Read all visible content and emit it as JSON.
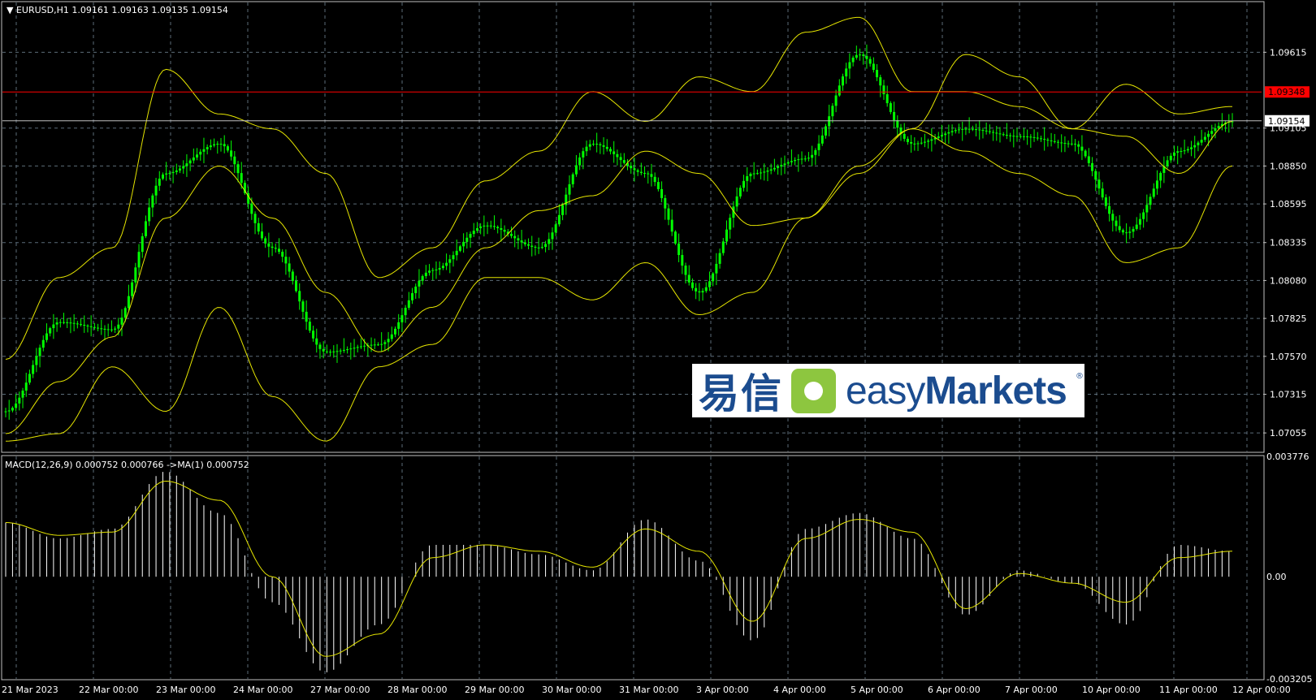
{
  "header": {
    "symbol": "EURUSD,H1",
    "ohlc": "1.09161 1.09163 1.09135 1.09154"
  },
  "macd_header": "MACD(12,26,9) 0.000752 0.000766 ->MA(1) 0.000752",
  "logo": {
    "cn": "易信",
    "en_light": "easy",
    "en_bold": "Markets",
    "reg": "®"
  },
  "colors": {
    "background": "#000000",
    "grid": "#5b6b78",
    "candles": "#00ff00",
    "bands": "#e6e600",
    "hline": "#ff0000",
    "last_price": "#c0c0c0",
    "macd_hist": "#ffffff"
  },
  "chart_data": [
    {
      "type": "line",
      "title": "EURUSD,H1",
      "ylim": [
        1.0693,
        1.0995
      ],
      "y_ticks": [
        "1.09615",
        "1.09105",
        "1.08850",
        "1.08595",
        "1.08335",
        "1.08080",
        "1.07825",
        "1.07570",
        "1.07315",
        "1.07055"
      ],
      "horizontal_line": {
        "value": "1.09348",
        "color": "#ff0000"
      },
      "last_price": "1.09154",
      "x_tick_labels": [
        "21 Mar 2023",
        "22 Mar 00:00",
        "23 Mar 00:00",
        "24 Mar 00:00",
        "27 Mar 00:00",
        "28 Mar 00:00",
        "29 Mar 00:00",
        "30 Mar 00:00",
        "31 Mar 00:00",
        "3 Apr 00:00",
        "4 Apr 00:00",
        "5 Apr 00:00",
        "6 Apr 00:00",
        "7 Apr 00:00",
        "10 Apr 00:00",
        "11 Apr 00:00",
        "12 Apr 00:00"
      ],
      "series": [
        {
          "name": "Bollinger middle",
          "values": [
            1.0705,
            1.074,
            1.077,
            1.085,
            1.0885,
            1.085,
            1.08,
            1.076,
            1.079,
            1.083,
            1.0855,
            1.0865,
            1.0895,
            1.088,
            1.0845,
            1.085,
            1.088,
            1.091,
            1.096,
            1.0945,
            1.091,
            1.0905,
            1.088,
            1.0915
          ]
        },
        {
          "name": "Bollinger upper",
          "values": [
            1.0755,
            1.081,
            1.083,
            1.095,
            1.092,
            1.091,
            1.088,
            1.081,
            1.083,
            1.0875,
            1.0895,
            1.0935,
            1.0915,
            1.0945,
            1.0935,
            1.0975,
            1.0985,
            1.0935,
            1.0935,
            1.0925,
            1.091,
            1.094,
            1.092,
            1.0925
          ]
        },
        {
          "name": "Bollinger lower",
          "values": [
            1.07,
            1.0705,
            1.075,
            1.072,
            1.079,
            1.073,
            1.07,
            1.075,
            1.0765,
            1.081,
            1.081,
            1.0795,
            1.082,
            1.0785,
            1.08,
            1.085,
            1.0885,
            1.091,
            1.0895,
            1.088,
            1.0865,
            1.082,
            1.083,
            1.0885
          ]
        },
        {
          "name": "Close",
          "values": [
            1.072,
            1.078,
            1.0775,
            1.088,
            1.09,
            1.083,
            1.076,
            1.0765,
            1.0815,
            1.0845,
            1.083,
            1.09,
            1.088,
            1.08,
            1.088,
            1.089,
            1.096,
            1.09,
            1.091,
            1.0905,
            1.09,
            1.084,
            1.0895,
            1.0915
          ]
        }
      ]
    },
    {
      "type": "bar",
      "title": "MACD(12,26,9)",
      "ylim": [
        -0.003205,
        0.003776
      ],
      "y_ticks": [
        "0.003776",
        "0.00",
        "-0.003205"
      ],
      "series": [
        {
          "name": "MACD",
          "values": [
            0.0017,
            0.0012,
            0.0015,
            0.0033,
            0.002,
            -0.0008,
            -0.003,
            -0.0015,
            0.001,
            0.001,
            0.0007,
            0.0002,
            0.0018,
            0.0005,
            -0.002,
            0.0015,
            0.002,
            0.0012,
            -0.0012,
            0.0002,
            -0.0002,
            -0.0015,
            0.001,
            0.0008
          ]
        },
        {
          "name": "Signal",
          "values": [
            0.0017,
            0.0013,
            0.0014,
            0.003,
            0.0024,
            0.0,
            -0.0025,
            -0.0018,
            0.0006,
            0.001,
            0.0008,
            0.0003,
            0.0015,
            0.0008,
            -0.0014,
            0.0012,
            0.0018,
            0.0014,
            -0.001,
            0.0001,
            -0.0002,
            -0.0008,
            0.0006,
            0.0008
          ]
        }
      ]
    }
  ]
}
